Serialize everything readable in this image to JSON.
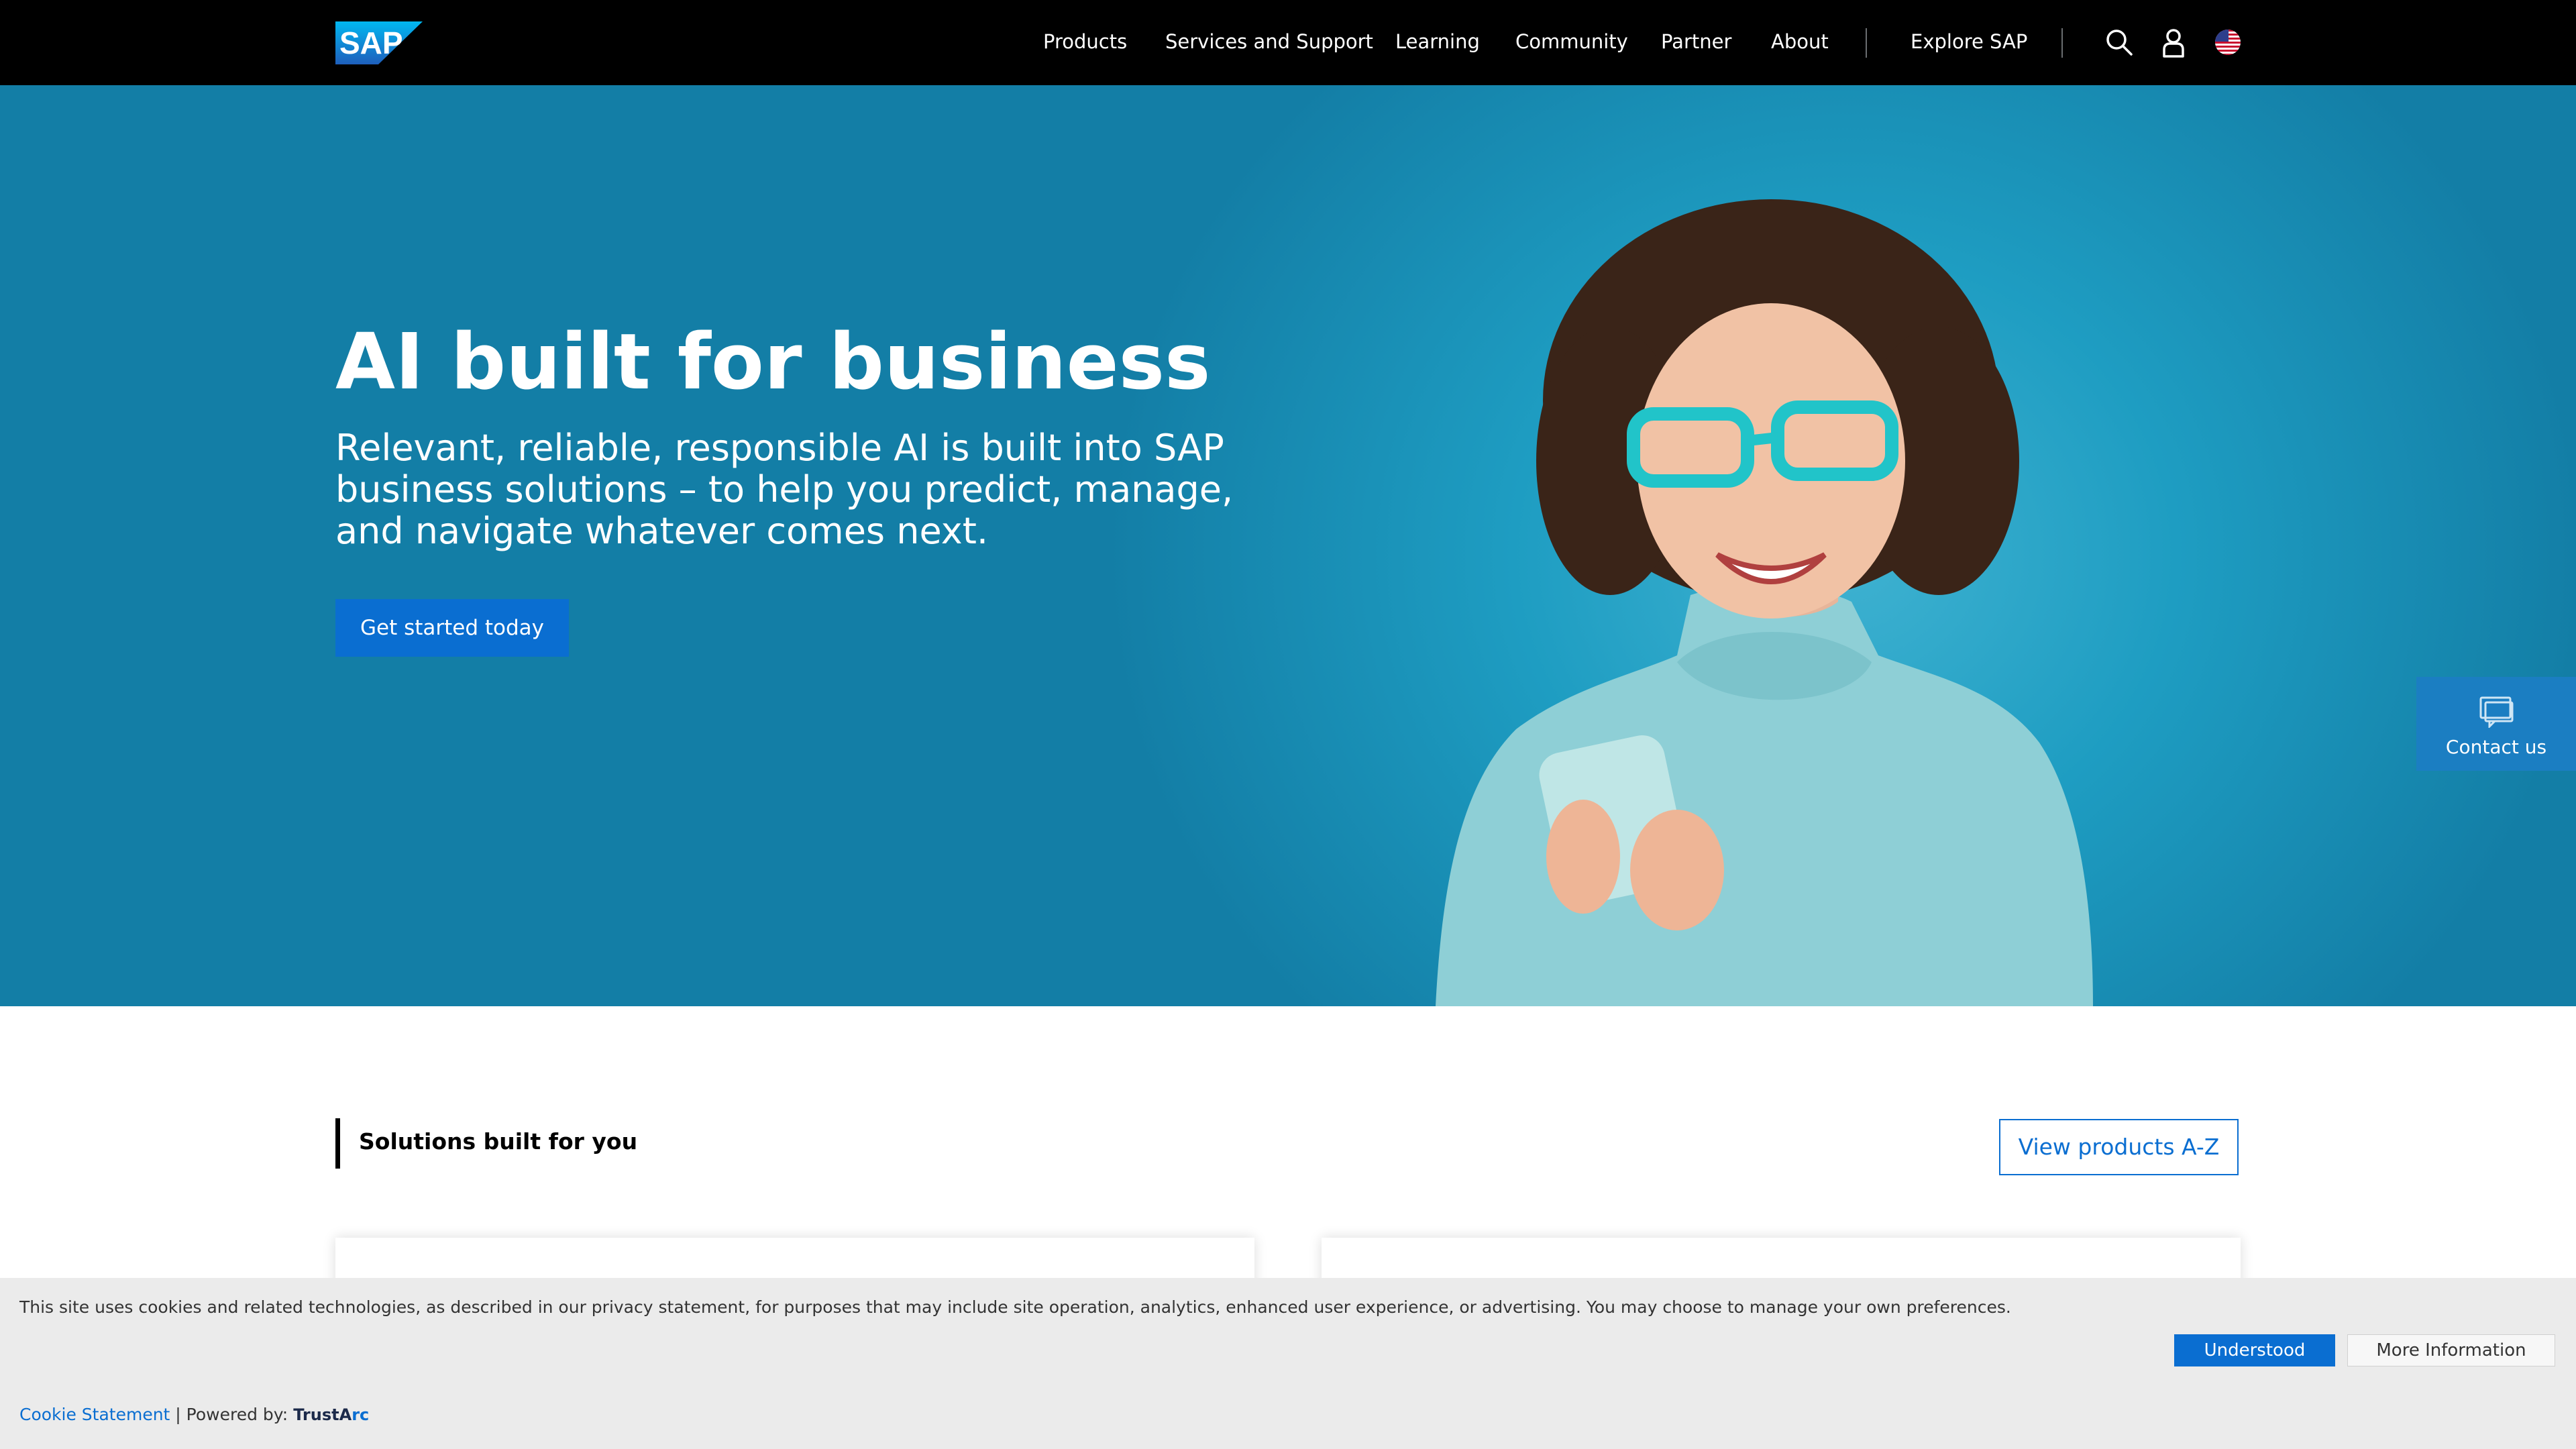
{
  "header": {
    "logo_text": "SAP",
    "nav": [
      "Products",
      "Services and Support",
      "Learning",
      "Community",
      "Partner",
      "About"
    ],
    "explore": "Explore SAP",
    "icons": [
      "search-icon",
      "user-icon",
      "us-flag-icon"
    ]
  },
  "hero": {
    "title": "AI built for business",
    "subtitle": "Relevant, reliable, responsible AI is built into SAP business solutions – to help you predict, manage, and navigate whatever comes next.",
    "cta": "Get started today",
    "contact_label": "Contact us"
  },
  "solutions": {
    "title": "Solutions built for you",
    "view_all": "View products A-Z"
  },
  "cookie": {
    "text": "This site uses cookies and related technologies, as described in our  privacy statement, for purposes that may include site operation, analytics, enhanced user experience, or advertising. You may choose to manage your own preferences.",
    "understood": "Understood",
    "more_info": "More Information",
    "statement_link": "Cookie Statement",
    "powered_by": " | Powered by:",
    "trustarc_a": "TrustA",
    "trustarc_b": "rc"
  },
  "colors": {
    "header_bg": "#000000",
    "hero_bg": "#1e9dc2",
    "cta_blue": "#0a6ed1",
    "contact_blue": "#1b7ec2",
    "cookie_bg": "#ebebeb"
  }
}
